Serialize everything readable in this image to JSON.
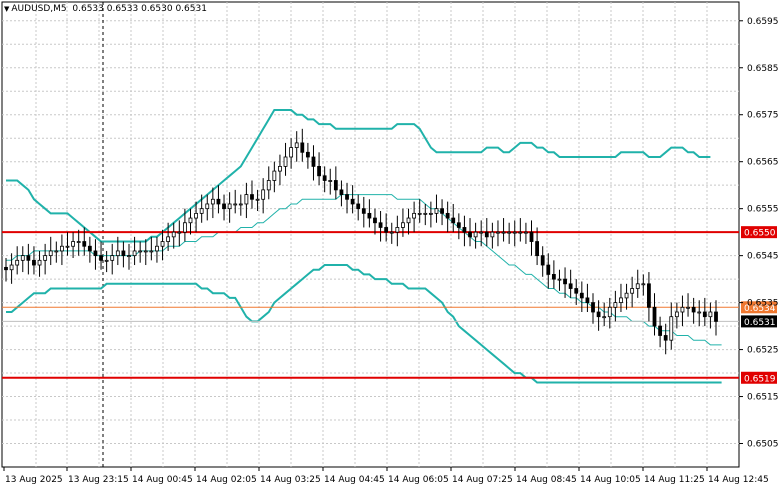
{
  "header": {
    "symbol_timeframe": "AUDUSD,M5",
    "ohlc": "0.6533 0.6533 0.6530 0.6531"
  },
  "colors": {
    "candle": "#000000",
    "grid": "#c8c8c8",
    "band": "#20b2aa",
    "support_resistance": "#e00000",
    "orange_level": "#f07830",
    "current_price_line": "#bfbfbf"
  },
  "chart_data": {
    "type": "candlestick",
    "title": "AUDUSD,M5",
    "ylim": [
      0.65,
      0.6599
    ],
    "y_ticks": [
      "0.6595",
      "0.6585",
      "0.6575",
      "0.6565",
      "0.6555",
      "0.6545",
      "0.6535",
      "0.6525",
      "0.6515",
      "0.6505"
    ],
    "x_ticks": [
      "13 Aug 2025",
      "13 Aug 23:15",
      "14 Aug 00:45",
      "14 Aug 02:05",
      "14 Aug 03:25",
      "14 Aug 04:45",
      "14 Aug 06:05",
      "14 Aug 07:25",
      "14 Aug 08:45",
      "14 Aug 10:05",
      "14 Aug 11:25",
      "14 Aug 12:45"
    ],
    "grid": true,
    "vertical_marker_after": "13 Aug 23:15",
    "levels": [
      {
        "label": "0.6550",
        "price": 0.655,
        "style": "red"
      },
      {
        "label": "0.6534",
        "price": 0.6534,
        "style": "orange"
      },
      {
        "label": "0.6519",
        "price": 0.6519,
        "style": "red"
      },
      {
        "label": "0.6531",
        "price": 0.6531,
        "style": "current"
      }
    ],
    "close": [
      0.6542,
      0.6543,
      0.6544,
      0.6545,
      0.6544,
      0.6543,
      0.6544,
      0.6545,
      0.6546,
      0.6546,
      0.6547,
      0.6547,
      0.6548,
      0.6548,
      0.6547,
      0.6546,
      0.6545,
      0.6544,
      0.6544,
      0.6545,
      0.6546,
      0.6545,
      0.6545,
      0.6546,
      0.6546,
      0.6546,
      0.6546,
      0.6547,
      0.6548,
      0.6549,
      0.655,
      0.655,
      0.6552,
      0.6553,
      0.6554,
      0.6555,
      0.6556,
      0.6557,
      0.6556,
      0.6555,
      0.6556,
      0.6556,
      0.6556,
      0.6558,
      0.6557,
      0.6557,
      0.6559,
      0.6561,
      0.6563,
      0.6564,
      0.6566,
      0.6568,
      0.6569,
      0.6567,
      0.6566,
      0.6564,
      0.6562,
      0.6561,
      0.6561,
      0.6559,
      0.6558,
      0.6557,
      0.6556,
      0.6555,
      0.6554,
      0.6553,
      0.6552,
      0.6551,
      0.655,
      0.655,
      0.6551,
      0.6552,
      0.6553,
      0.6554,
      0.6554,
      0.6554,
      0.6554,
      0.6555,
      0.6554,
      0.6553,
      0.6552,
      0.6551,
      0.655,
      0.6549,
      0.655,
      0.655,
      0.6549,
      0.655,
      0.655,
      0.655,
      0.655,
      0.655,
      0.655,
      0.655,
      0.6548,
      0.6545,
      0.6543,
      0.6541,
      0.654,
      0.654,
      0.6539,
      0.6538,
      0.6537,
      0.6536,
      0.6535,
      0.6533,
      0.6532,
      0.6532,
      0.6534,
      0.6535,
      0.6536,
      0.6537,
      0.6538,
      0.6539,
      0.6539,
      0.6534,
      0.653,
      0.6528,
      0.6527,
      0.6532,
      0.6533,
      0.6534,
      0.6534,
      0.6533,
      0.6533,
      0.6532,
      0.6533,
      0.6531
    ],
    "series": [
      {
        "name": "",
        "values": [
          0.6561,
          0.6561,
          0.6561,
          0.656,
          0.6559,
          0.6557,
          0.6556,
          0.6555,
          0.6554,
          0.6554,
          0.6554,
          0.6554,
          0.6553,
          0.6552,
          0.6551,
          0.655,
          0.6549,
          0.6548,
          0.6548,
          0.6548,
          0.6548,
          0.6548,
          0.6548,
          0.6548,
          0.6548,
          0.6548,
          0.6549,
          0.6549,
          0.655,
          0.6551,
          0.6552,
          0.6553,
          0.6554,
          0.6555,
          0.6556,
          0.6557,
          0.6558,
          0.6559,
          0.656,
          0.6561,
          0.6562,
          0.6563,
          0.6564,
          0.6566,
          0.6568,
          0.657,
          0.6572,
          0.6574,
          0.6576,
          0.6576,
          0.6576,
          0.6576,
          0.6575,
          0.6575,
          0.6574,
          0.6574,
          0.6573,
          0.6573,
          0.6573,
          0.6572,
          0.6572,
          0.6572,
          0.6572,
          0.6572,
          0.6572,
          0.6572,
          0.6572,
          0.6572,
          0.6572,
          0.6572,
          0.6573,
          0.6573,
          0.6573,
          0.6573,
          0.6572,
          0.657,
          0.6568,
          0.6567,
          0.6567,
          0.6567,
          0.6567,
          0.6567,
          0.6567,
          0.6567,
          0.6567,
          0.6567,
          0.6568,
          0.6568,
          0.6568,
          0.6567,
          0.6567,
          0.6568,
          0.6569,
          0.6569,
          0.6569,
          0.6568,
          0.6568,
          0.6567,
          0.6567,
          0.6566,
          0.6566,
          0.6566,
          0.6566,
          0.6566,
          0.6566,
          0.6566,
          0.6566,
          0.6566,
          0.6566,
          0.6566,
          0.6567,
          0.6567,
          0.6567,
          0.6567,
          0.6567,
          0.6566,
          0.6566,
          0.6566,
          0.6567,
          0.6568,
          0.6568,
          0.6568,
          0.6567,
          0.6567,
          0.6566,
          0.6566,
          0.6566
        ]
      },
      {
        "name": "",
        "values": [
          0.6544,
          0.6544,
          0.6545,
          0.6545,
          0.6545,
          0.6546,
          0.6546,
          0.6546,
          0.6546,
          0.6546,
          0.6546,
          0.6546,
          0.6546,
          0.6546,
          0.6546,
          0.6546,
          0.6545,
          0.6545,
          0.6545,
          0.6545,
          0.6545,
          0.6545,
          0.6545,
          0.6545,
          0.6546,
          0.6546,
          0.6546,
          0.6546,
          0.6546,
          0.6547,
          0.6547,
          0.6547,
          0.6548,
          0.6548,
          0.6548,
          0.6549,
          0.6549,
          0.6549,
          0.655,
          0.655,
          0.655,
          0.655,
          0.6551,
          0.6551,
          0.6551,
          0.6552,
          0.6552,
          0.6553,
          0.6554,
          0.6555,
          0.6555,
          0.6556,
          0.6556,
          0.6557,
          0.6557,
          0.6557,
          0.6557,
          0.6557,
          0.6557,
          0.6557,
          0.6558,
          0.6558,
          0.6558,
          0.6558,
          0.6558,
          0.6558,
          0.6558,
          0.6558,
          0.6558,
          0.6558,
          0.6557,
          0.6557,
          0.6557,
          0.6557,
          0.6557,
          0.6556,
          0.6555,
          0.6555,
          0.6554,
          0.6553,
          0.6552,
          0.6551,
          0.655,
          0.6549,
          0.6548,
          0.6548,
          0.6547,
          0.6546,
          0.6545,
          0.6544,
          0.6543,
          0.6543,
          0.6542,
          0.6541,
          0.6541,
          0.654,
          0.6539,
          0.6538,
          0.6538,
          0.6537,
          0.6537,
          0.6536,
          0.6536,
          0.6535,
          0.6535,
          0.6534,
          0.6534,
          0.6533,
          0.6533,
          0.6532,
          0.6532,
          0.6532,
          0.6531,
          0.6531,
          0.6531,
          0.653,
          0.653,
          0.6529,
          0.6529,
          0.6529,
          0.6528,
          0.6528,
          0.6528,
          0.6527,
          0.6527,
          0.6527,
          0.6526,
          0.6526,
          0.6526
        ]
      },
      {
        "name": "",
        "values": [
          0.6533,
          0.6533,
          0.6534,
          0.6535,
          0.6536,
          0.6537,
          0.6537,
          0.6537,
          0.6538,
          0.6538,
          0.6538,
          0.6538,
          0.6538,
          0.6538,
          0.6538,
          0.6538,
          0.6538,
          0.6538,
          0.6539,
          0.6539,
          0.6539,
          0.6539,
          0.6539,
          0.6539,
          0.6539,
          0.6539,
          0.6539,
          0.6539,
          0.6539,
          0.6539,
          0.6539,
          0.6539,
          0.6539,
          0.6539,
          0.6539,
          0.6538,
          0.6538,
          0.6537,
          0.6537,
          0.6537,
          0.6536,
          0.6536,
          0.6534,
          0.6532,
          0.6531,
          0.6531,
          0.6532,
          0.6533,
          0.6535,
          0.6536,
          0.6537,
          0.6538,
          0.6539,
          0.654,
          0.6541,
          0.6542,
          0.6542,
          0.6543,
          0.6543,
          0.6543,
          0.6543,
          0.6543,
          0.6542,
          0.6542,
          0.6541,
          0.6541,
          0.654,
          0.654,
          0.654,
          0.6539,
          0.6539,
          0.6539,
          0.6538,
          0.6538,
          0.6538,
          0.6538,
          0.6537,
          0.6536,
          0.6535,
          0.6533,
          0.6532,
          0.653,
          0.6529,
          0.6528,
          0.6527,
          0.6526,
          0.6525,
          0.6524,
          0.6523,
          0.6522,
          0.6521,
          0.652,
          0.652,
          0.6519,
          0.6519,
          0.6518,
          0.6518,
          0.6518,
          0.6518,
          0.6518,
          0.6518,
          0.6518,
          0.6518,
          0.6518,
          0.6518,
          0.6518,
          0.6518,
          0.6518,
          0.6518,
          0.6518,
          0.6518,
          0.6518,
          0.6518,
          0.6518,
          0.6518,
          0.6518,
          0.6518,
          0.6518,
          0.6518,
          0.6518,
          0.6518,
          0.6518,
          0.6518,
          0.6518,
          0.6518,
          0.6518,
          0.6518,
          0.6518,
          0.6518
        ]
      }
    ]
  }
}
